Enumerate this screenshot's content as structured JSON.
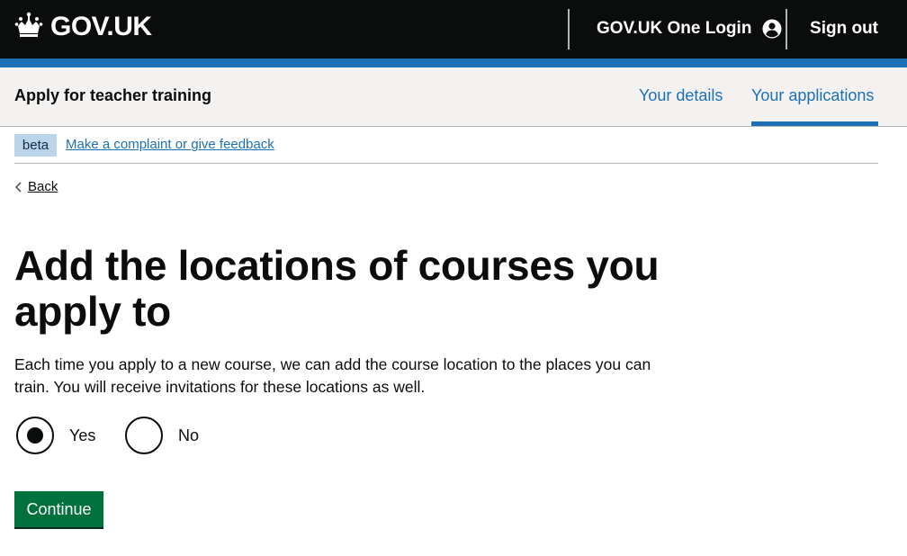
{
  "header": {
    "logo_text": "GOV.UK",
    "one_login_label": "GOV.UK One Login",
    "sign_out_label": "Sign out"
  },
  "service": {
    "name": "Apply for teacher training",
    "nav": [
      {
        "label": "Your details",
        "active": false
      },
      {
        "label": "Your applications",
        "active": true
      }
    ]
  },
  "phase_banner": {
    "tag": "beta",
    "link_text": "Make a complaint or give feedback"
  },
  "back_link": "Back",
  "page": {
    "heading": "Add the locations of courses you apply to",
    "body": "Each time you apply to a new course, we can add the course location to the places you can train. You will receive invitations for these locations as well."
  },
  "radios": {
    "options": [
      {
        "label": "Yes",
        "checked": true
      },
      {
        "label": "No",
        "checked": false
      }
    ]
  },
  "continue_label": "Continue",
  "colors": {
    "header_bg": "#0b0c0c",
    "brand_blue": "#1d70b8",
    "button_green": "#00703c",
    "nav_bg": "#f3f2f1",
    "beta_tag_bg": "#bbd4ea"
  }
}
